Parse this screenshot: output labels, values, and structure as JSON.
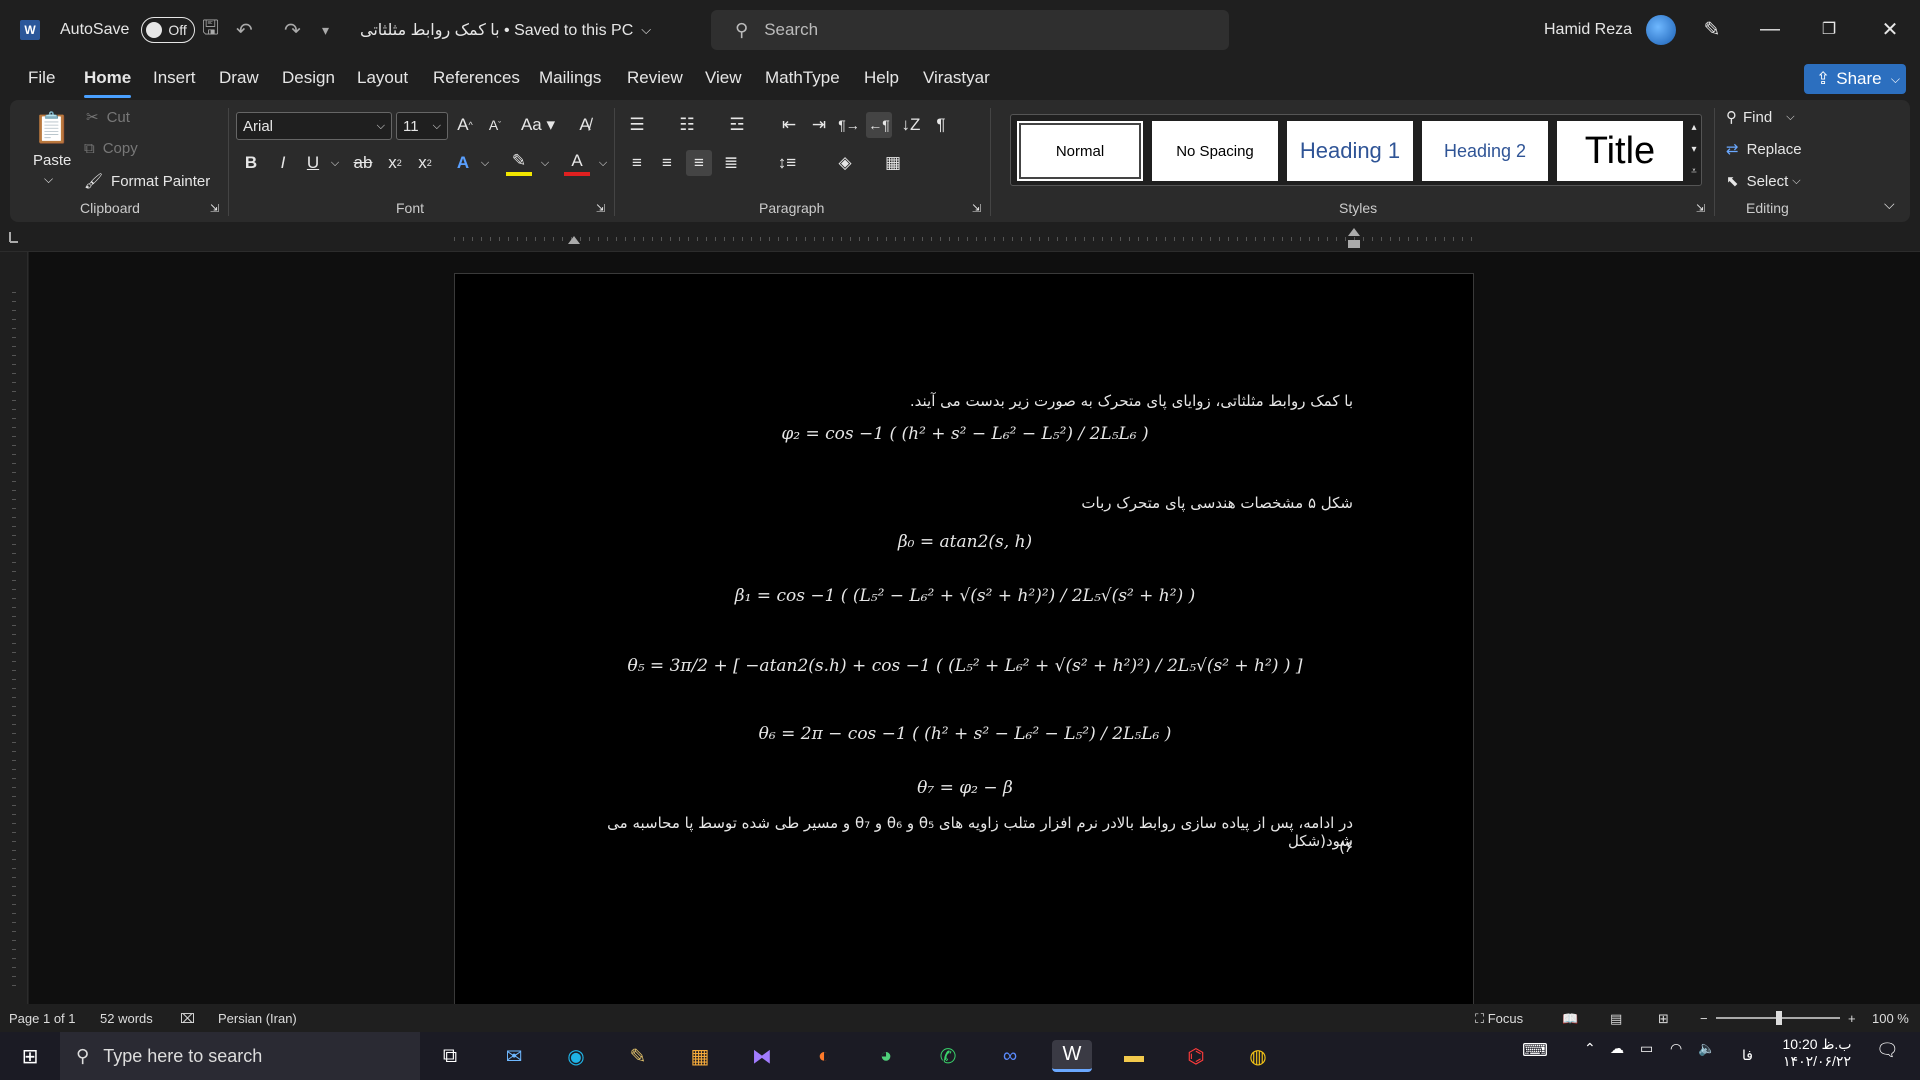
{
  "titlebar": {
    "app_logo": "W",
    "autosave_label": "AutoSave",
    "autosave_state": "Off",
    "doc_title": "با کمک روابط مثلثاتی • Saved to this PC",
    "search_placeholder": "Search",
    "user_name": "Hamid Reza"
  },
  "menu": {
    "tabs": [
      "File",
      "Home",
      "Insert",
      "Draw",
      "Design",
      "Layout",
      "References",
      "Mailings",
      "Review",
      "View",
      "MathType",
      "Help",
      "Virastyar"
    ],
    "active_tab": "Home",
    "share_label": "Share"
  },
  "ribbon": {
    "clipboard": {
      "paste": "Paste",
      "cut": "Cut",
      "copy": "Copy",
      "format_painter": "Format Painter",
      "label": "Clipboard"
    },
    "font": {
      "family": "Arial",
      "size": "11",
      "label": "Font"
    },
    "paragraph": {
      "label": "Paragraph"
    },
    "styles": {
      "items": [
        "Normal",
        "No Spacing",
        "Heading 1",
        "Heading 2",
        "Title"
      ],
      "label": "Styles"
    },
    "editing": {
      "find": "Find",
      "replace": "Replace",
      "select": "Select",
      "label": "Editing"
    }
  },
  "document": {
    "para1": "با کمک روابط مثلثاتی، زوایای پای متحرک به صورت زیر بدست می آیند.",
    "eq1": "φ₂ = cos −1 ( (h² + s² − L₆² − L₅²) / 2L₅L₆ )",
    "caption": "شکل ۵ مشخصات هندسی پای متحرک ربات",
    "eq2": "β₀ = atan2(s, h)",
    "eq3": "β₁ = cos −1 ( (L₅² − L₆² + √(s² + h²)²) / 2L₅√(s² + h²) )",
    "eq4": "θ₅ = 3π/2 + [ −atan2(s.h) + cos −1 ( (L₅² + L₆² + √(s² + h²)²) / 2L₅√(s² + h²) ) ]",
    "eq5": "θ₆ = 2π − cos −1 ( (h² + s² − L₆² − L₅²) / 2L₅L₆ )",
    "eq6": "θ₇ = φ₂ − β",
    "para2_line1": "در ادامه، پس از پیاده سازی روابط بالادر نرم افزار متلب زاویه های θ₅ و θ₆ و θ₇ و مسیر طی شده توسط پا محاسبه می شود(شکل",
    "para2_line2": "۶)"
  },
  "status": {
    "page": "Page 1 of 1",
    "words": "52 words",
    "language": "Persian (Iran)",
    "focus": "Focus",
    "zoom": "100 %"
  },
  "taskbar": {
    "search_placeholder": "Type here to search",
    "time": "10:20 ب.ظ",
    "date": "۱۴۰۲/۰۶/۲۲",
    "lang": "فا"
  }
}
